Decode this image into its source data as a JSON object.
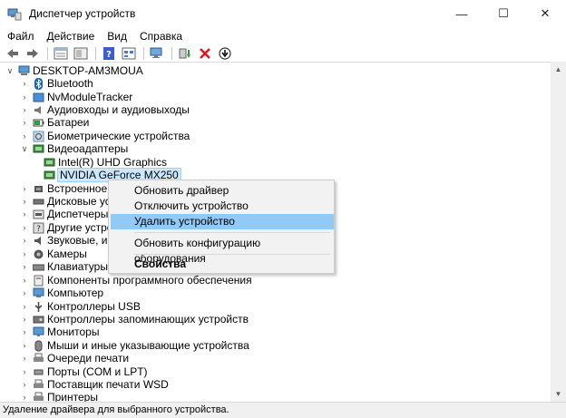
{
  "window": {
    "title": "Диспетчер устройств",
    "controls": {
      "minimize": "—",
      "maximize": "☐",
      "close": "✕"
    }
  },
  "menu": [
    "Файл",
    "Действие",
    "Вид",
    "Справка"
  ],
  "toolbar": {
    "icons": [
      "back-icon",
      "forward-icon",
      "properties-icon",
      "show-hide-icon",
      "help-icon",
      "view-icon",
      "scan-hardware-icon",
      "update-driver-icon",
      "uninstall-icon",
      "disable-icon"
    ]
  },
  "tree": {
    "root": "DESKTOP-AM3MOUA",
    "categories": [
      "Bluetooth",
      "NvModuleTracker",
      "Аудиовходы и аудиовыходы",
      "Батареи",
      "Биометрические устройства",
      "Видеоадаптеры",
      "Intel(R) UHD Graphics",
      "NVIDIA GeForce MX250",
      "Встроенное ПО",
      "Дисковые устро",
      "Диспетчеры US",
      "Другие устройс",
      "Звуковые, игрове",
      "Камеры",
      "Клавиатуры",
      "Компоненты программного обеспечения",
      "Компьютер",
      "Контроллеры USB",
      "Контроллеры запоминающих устройств",
      "Мониторы",
      "Мыши и иные указывающие устройства",
      "Очереди печати",
      "Порты (COM и LPT)",
      "Поставщик печати WSD",
      "Принтеры"
    ]
  },
  "context_menu": {
    "items": [
      "Обновить драйвер",
      "Отключить устройство",
      "Удалить устройство",
      "Обновить конфигурацию оборудования",
      "Свойства"
    ],
    "highlighted_index": 2
  },
  "status": "Удаление драйвера для выбранного устройства.",
  "colors": {
    "selection": "#cce8ff",
    "menu_highlight": "#91c9f7",
    "uninstall_red": "#e81123",
    "update_green": "#2e9e3e"
  }
}
